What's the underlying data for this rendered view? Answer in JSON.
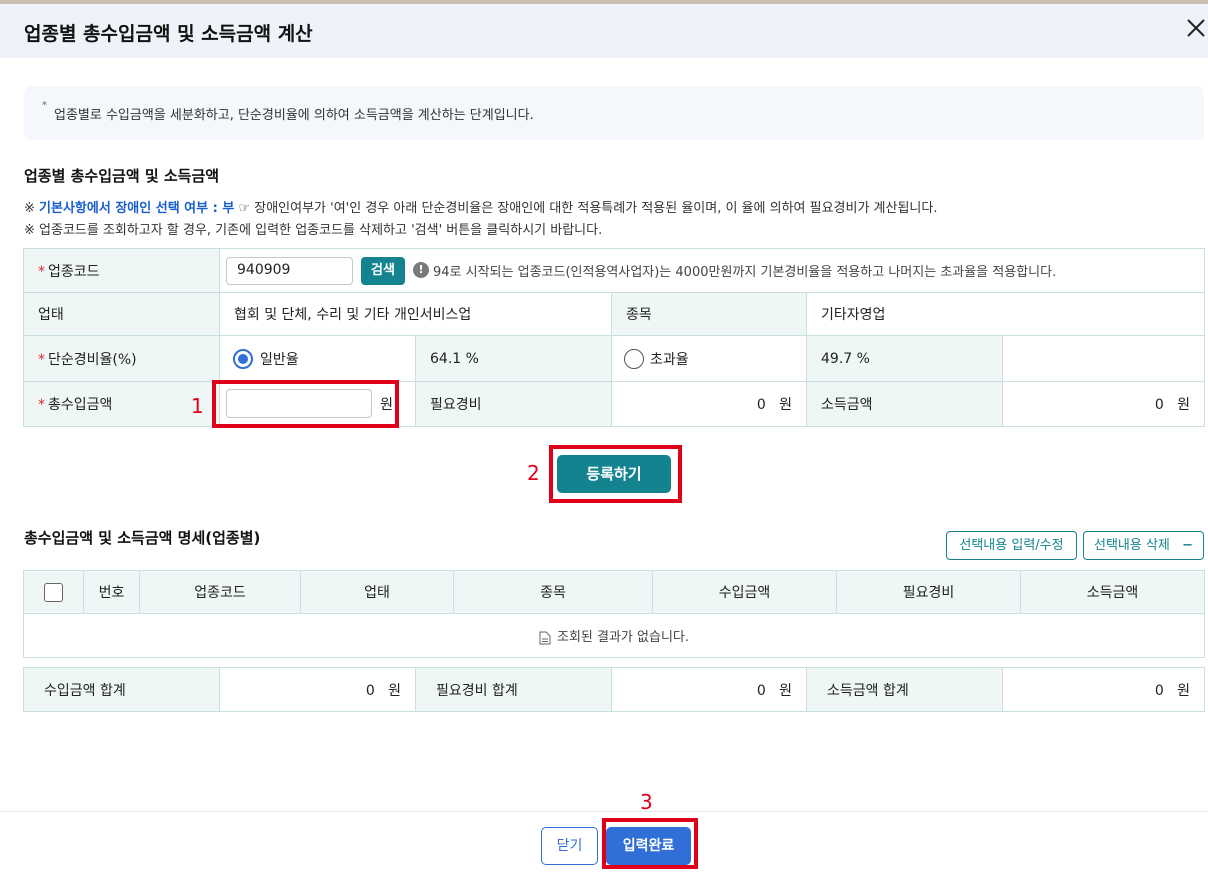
{
  "dialog": {
    "title": "업종별 총수입금액 및 소득금액 계산",
    "close_label": "✕"
  },
  "notice": {
    "bullet": "*",
    "text": "업종별로 수입금액을 세분화하고, 단순경비율에 의하여 소득금액을 계산하는 단계입니다."
  },
  "section1": {
    "title": "업종별 총수입금액 및 소득금액",
    "note1_prefix": "※",
    "note1_blue": "기본사항에서 장애인 선택 여부 : 부",
    "note1_rest": "☞ 장애인여부가 '여'인 경우 아래 단순경비율은 장애인에 대한 적용특례가 적용된 율이며, 이 율에 의하여 필요경비가 계산됩니다.",
    "note2": "※ 업종코드를 조회하고자 할 경우, 기존에 입력한 업종코드를 삭제하고 '검색' 버튼을 클릭하시기 바랍니다."
  },
  "form": {
    "required_mark": "*",
    "code_label": "업종코드",
    "code_value": "940909",
    "search_label": "검색",
    "info_icon": "!",
    "info_text": "94로 시작되는 업종코드(인적용역사업자)는 4000만원까지 기본경비율을 적용하고 나머지는 초과율을 적용합니다.",
    "business_label": "업태",
    "business_value": "협회 및 단체, 수리 및 기타 개인서비스업",
    "item_label": "종목",
    "item_value": "기타자영업",
    "rate_label": "단순경비율(%)",
    "rate_general_label": "일반율",
    "rate_general_value": "64.1 %",
    "rate_excess_label": "초과율",
    "rate_excess_value": "49.7 %",
    "income_label": "총수입금액",
    "income_unit": "원",
    "expense_label": "필요경비",
    "expense_value": "0",
    "expense_unit": "원",
    "profit_label": "소득금액",
    "profit_value": "0",
    "profit_unit": "원"
  },
  "annotations": {
    "step1": "1",
    "step2": "2",
    "step3": "3"
  },
  "register_label": "등록하기",
  "section2": {
    "title": "총수입금액 및 소득금액 명세(업종별)",
    "edit_label": "선택내용 입력/수정",
    "delete_label": "선택내용 삭제",
    "delete_icon": "−",
    "columns": [
      "번호",
      "업종코드",
      "업태",
      "종목",
      "수입금액",
      "필요경비",
      "소득금액"
    ],
    "empty_text": "조회된 결과가 없습니다."
  },
  "totals": {
    "income_label": "수입금액 합계",
    "income_value": "0",
    "income_unit": "원",
    "expense_label": "필요경비 합계",
    "expense_value": "0",
    "expense_unit": "원",
    "profit_label": "소득금액 합계",
    "profit_value": "0",
    "profit_unit": "원"
  },
  "footer": {
    "close_label": "닫기",
    "done_label": "입력완료"
  }
}
